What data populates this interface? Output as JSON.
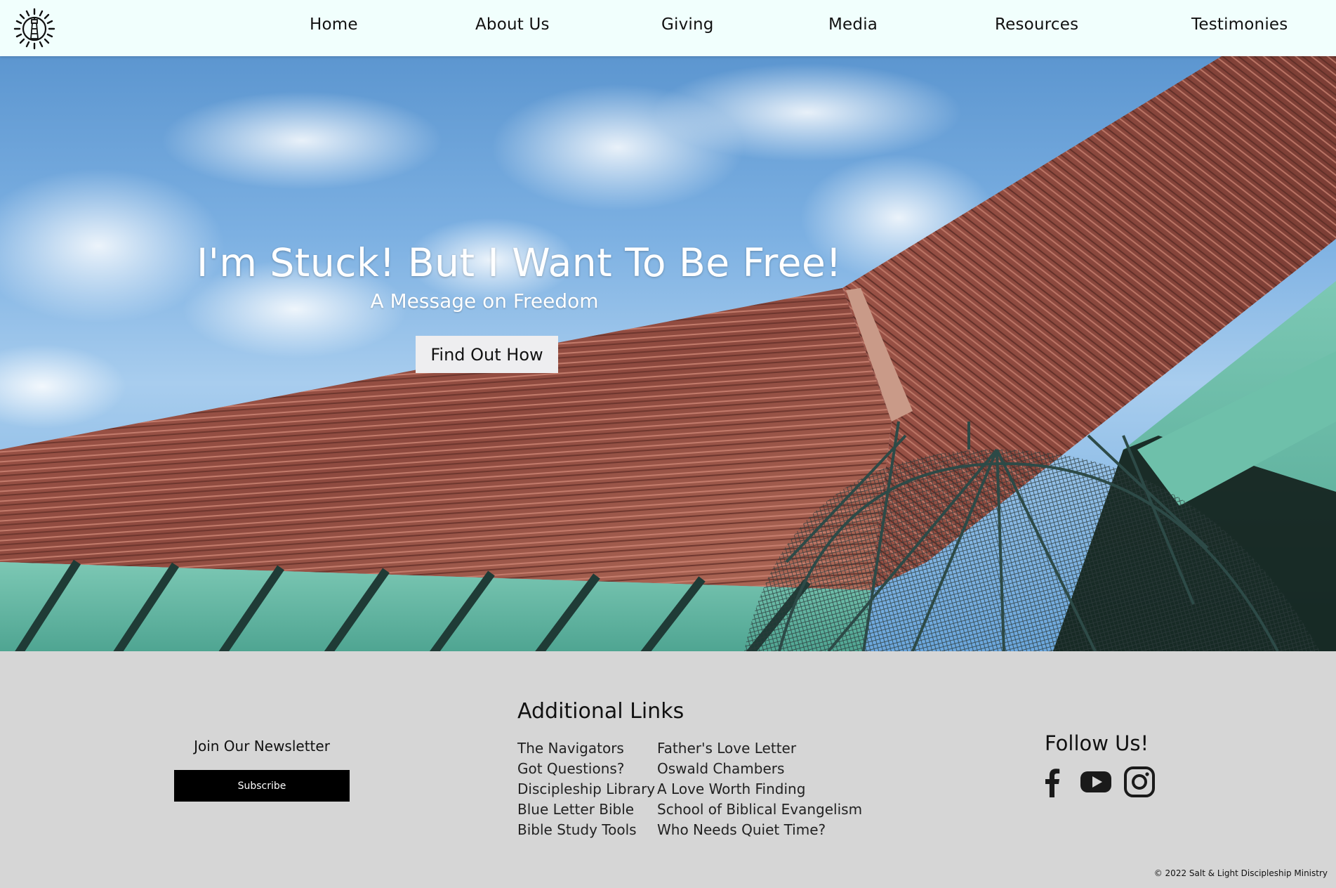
{
  "nav": {
    "logo_icon": "sun-lighthouse-logo-icon",
    "items": [
      {
        "label": "Home"
      },
      {
        "label": "About Us"
      },
      {
        "label": "Giving"
      },
      {
        "label": "Media"
      },
      {
        "label": "Resources"
      },
      {
        "label": "Testimonies"
      }
    ]
  },
  "hero": {
    "background": "copper-roof-and-sky-photo",
    "title": "I'm Stuck! But I Want To Be Free!",
    "subtitle": "A Message on Freedom",
    "button_label": "Find Out How"
  },
  "footer": {
    "newsletter": {
      "title": "Join Our Newsletter",
      "button_label": "Subscribe"
    },
    "links": {
      "heading": "Additional Links",
      "column1": [
        "The Navigators",
        "Got Questions?",
        "Discipleship Library",
        "Blue Letter Bible",
        "Bible Study Tools"
      ],
      "column2": [
        "Father's Love Letter",
        "Oswald Chambers",
        "A Love Worth Finding",
        "School of Biblical Evangelism",
        "Who Needs Quiet Time?"
      ]
    },
    "follow": {
      "heading": "Follow Us!",
      "icons": [
        "facebook-icon",
        "youtube-icon",
        "instagram-icon"
      ]
    },
    "copyright": "© 2022 Salt & Light Discipleship Ministry"
  },
  "colors": {
    "header_bg": "#f1fffd",
    "footer_bg": "#d6d6d6",
    "roof": "#9e5448",
    "copper_green": "#5fb8a4",
    "sky": "#6aa6dc"
  }
}
